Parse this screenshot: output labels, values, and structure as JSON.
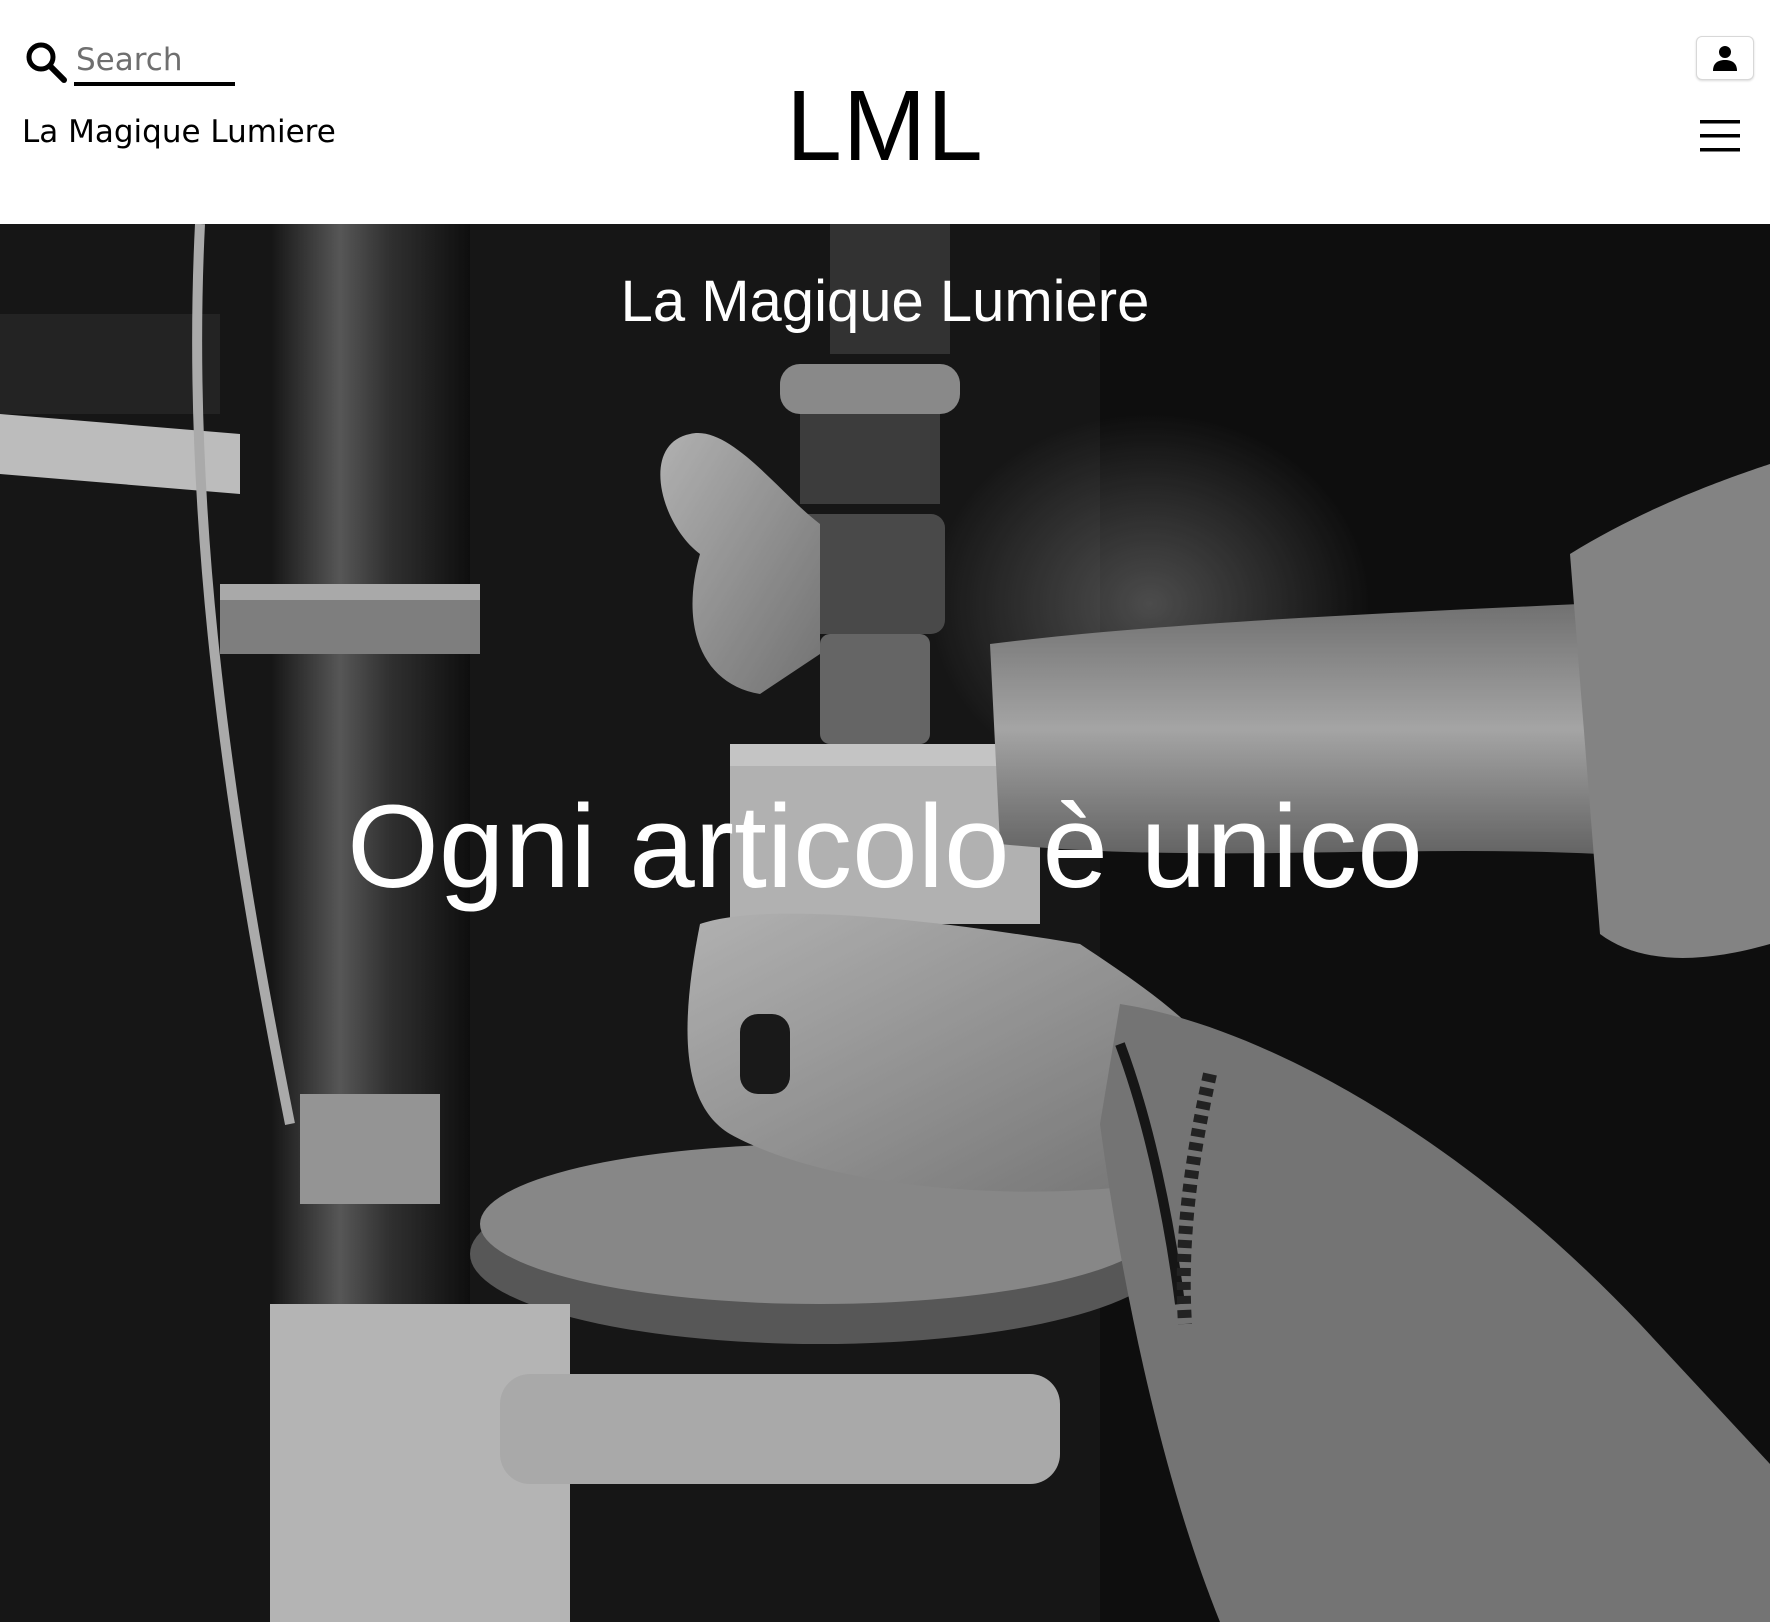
{
  "header": {
    "search": {
      "placeholder": "Search",
      "icon": "search-icon"
    },
    "brand_name": "La Magique Lumiere",
    "logo": "LML",
    "account_icon": "user-icon",
    "menu_icon": "hamburger-menu-icon"
  },
  "hero": {
    "subtitle": "La Magique Lumiere",
    "title": "Ogni articolo è unico",
    "image": "black-and-white-photo-hands-drill-press-wood-block"
  }
}
